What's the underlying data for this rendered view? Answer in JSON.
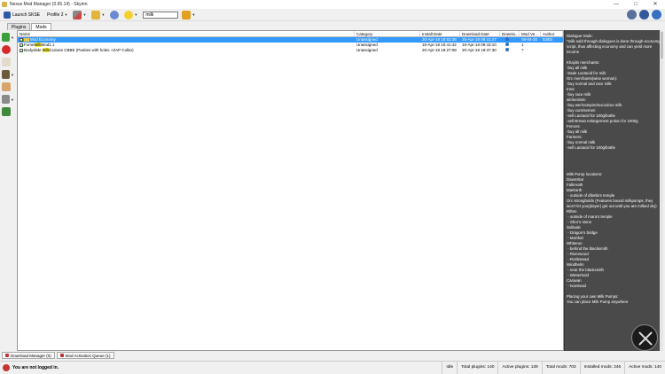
{
  "window": {
    "title": "Nexus Mod Manager (0.65.14) - Skyrim"
  },
  "toolbar": {
    "launch_label": "Launch SKSE",
    "profile_label": "Profile 2",
    "search_value": "milk"
  },
  "tabs": [
    {
      "label": "Plugins"
    },
    {
      "label": "Mods"
    }
  ],
  "grid": {
    "columns": [
      "Name",
      "Category",
      "Install Date",
      "Download Date",
      "Downlo...",
      "Mod Ve...",
      "Author"
    ],
    "rows": [
      {
        "name_pre": "Mod Economy",
        "name_hl": "",
        "name_post": "",
        "category": "Unassigned",
        "install": "20-Apr-18 19:53:36",
        "download": "20-Apr-18 09:41:47",
        "version": "08-04-20",
        "author": "EdEb",
        "selected": true,
        "folder": true
      },
      {
        "name_pre": "Fome",
        "name_hl": "Milk",
        "name_post": "Mod1.1",
        "category": "Unassigned",
        "install": "16-Apr-18 10:41:42",
        "download": "16-Apr-18 09:43:10",
        "version": "1",
        "author": "",
        "selected": false,
        "folder": false
      },
      {
        "name_pre": "Bodyslide ",
        "name_hl": "Milk",
        "name_post": "Cuirass CBBE (Panties with holes +ZAP Collar)",
        "category": "Unassigned",
        "install": "20-Apr-18 19:27:08",
        "download": "20-Apr-18 19:37:30",
        "version": "?",
        "author": "",
        "selected": false,
        "folder": false
      }
    ]
  },
  "description": "Dialogue trade:\n*milk sold through dialogues is done through economy script, thus affecting economy and can yield more income\n\nKhajiits merchants:\n-buy all milk\n-trade Lactacid for milk\nOrc merchants(wise woman):\n-buy normal and race milk\nInns:\n-buy race milk\nalchemists:\n-buy wer/vampire/succubus milk\n-buy cum/semen\n-sell Lactacid for 100g/bottle\n-sell Breast enlargement potion for 1000g\nFences:\n-buy all milk\nFarmers:\n-buy normal milk\n-sell Lactacid for 100g/bottle\n\n\n\n\nMilk Pump locations:\nDawnStar\nFalkreath\nMarkarth\n - outside of dibella's temple\nOrc strongholds (Features bound milkpumps, they won't let you(player) get out until you are milked dry)\nRiften\n - outside of mara's temple\n - Shor's stone\nSolitude\n - Dragon's bridge\n - Morthal\nWhiterun\n - behind the blacksmith\n - Riverwood\n - Rorikstead\nWindhelm\n - near the blacksmith\n - Winterhold\nCaravan\n - Ivarstead\n\nPlacing your own Milk Pumps:\nYou can place Milk Pump anywhere",
  "bottom_tabs": [
    {
      "label": "Download Manager (0)"
    },
    {
      "label": "Mod Activation Queue (1)"
    }
  ],
  "status": {
    "login": "You are not logged in.",
    "idle": "Idle",
    "total_plugins": "Total plugins: 140",
    "active_plugins": "Active plugins:  139",
    "total_mods": "Total mods: 703",
    "installed_mods": "Installed mods: 246",
    "active_mods": "Active mods: 140"
  },
  "colors": {
    "selection": "#3399ff",
    "highlight": "#f5ef3a",
    "description_bg": "#4a4a4a"
  }
}
